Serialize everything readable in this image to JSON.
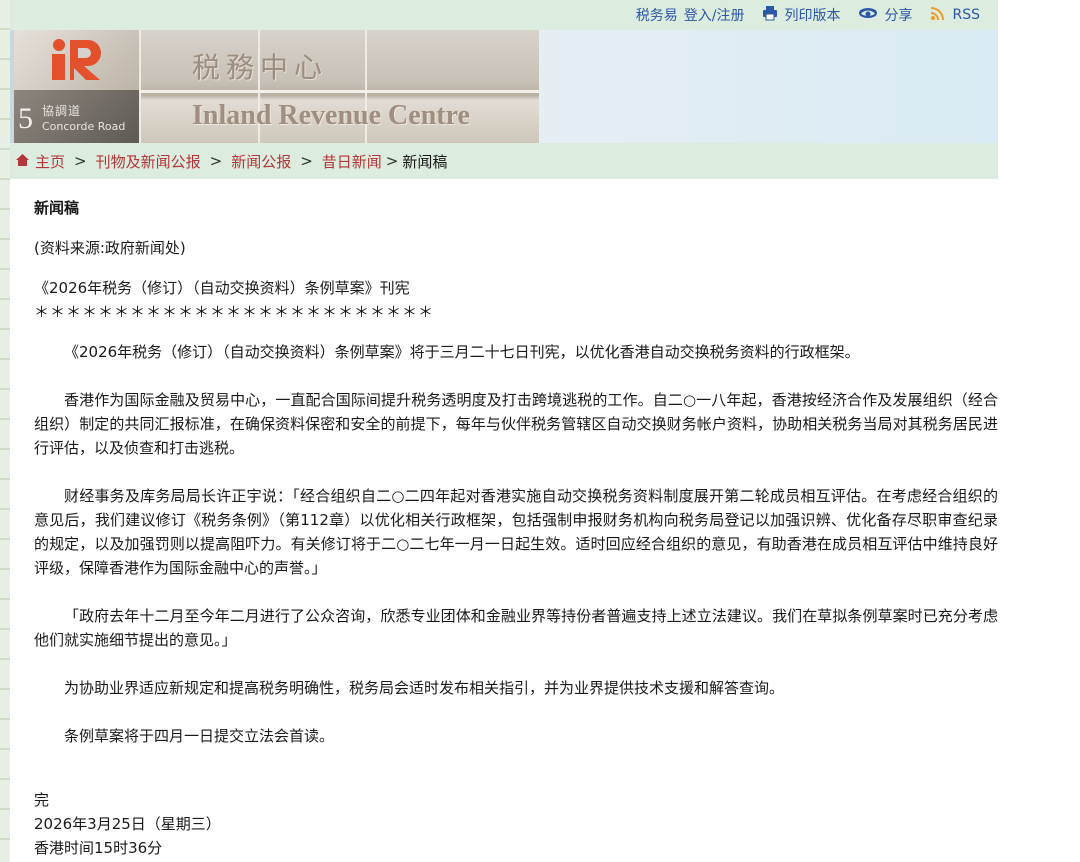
{
  "topbar": {
    "etax": "税务易",
    "login": "登入/注册",
    "print": "列印版本",
    "share": "分享",
    "rss": "RSS"
  },
  "banner": {
    "road_number": "5",
    "road_cn": "協調道",
    "road_en": "Concorde Road",
    "title_cn": "税務中心",
    "title_en": "Inland Revenue Centre"
  },
  "breadcrumb": {
    "home": "主页",
    "items": [
      "刊物及新闻公报",
      "新闻公报",
      "昔日新闻"
    ],
    "sep": ">",
    "current": "新闻稿"
  },
  "article": {
    "heading": "新闻稿",
    "source": "(资料来源:政府新闻处)",
    "title": "《2026年税务（修订）（自动交换资料）条例草案》刊宪",
    "stars": "＊＊＊＊＊＊＊＊＊＊＊＊＊＊＊＊＊＊＊＊＊＊＊＊＊",
    "paragraphs": [
      "《2026年税务（修订）（自动交换资料）条例草案》将于三月二十七日刊宪，以优化香港自动交换税务资料的行政框架。",
      "香港作为国际金融及贸易中心，一直配合国际间提升税务透明度及打击跨境逃税的工作。自二○一八年起，香港按经济合作及发展组织（经合组织）制定的共同汇报标准，在确保资料保密和安全的前提下，每年与伙伴税务管辖区自动交换财务帐户资料，协助相关税务当局对其税务居民进行评估，以及侦查和打击逃税。",
      "财经事务及库务局局长许正宇说：「经合组织自二○二四年起对香港实施自动交换税务资料制度展开第二轮成员相互评估。在考虑经合组织的意见后，我们建议修订《税务条例》（第112章）以优化相关行政框架，包括强制申报财务机构向税务局登记以加强识辨、优化备存尽职审查纪录的规定，以及加强罚则以提高阻吓力。有关修订将于二○二七年一月一日起生效。适时回应经合组织的意见，有助香港在成员相互评估中维持良好评级，保障香港作为国际金融中心的声誉。」",
      "「政府去年十二月至今年二月进行了公众咨询，欣悉专业团体和金融业界等持份者普遍支持上述立法建议。我们在草拟条例草案时已充分考虑他们就实施细节提出的意见。」",
      "为协助业界适应新规定和提高税务明确性，税务局会适时发布相关指引，并为业界提供技术支援和解答查询。",
      "条例草案将于四月一日提交立法会首读。"
    ],
    "end": "完",
    "date": "2026年3月25日（星期三）",
    "time": "香港时间15时36分"
  },
  "colors": {
    "green_bar": "#dcecdf",
    "link_blue": "#2c57a8",
    "crumb_red": "#b5363a"
  }
}
